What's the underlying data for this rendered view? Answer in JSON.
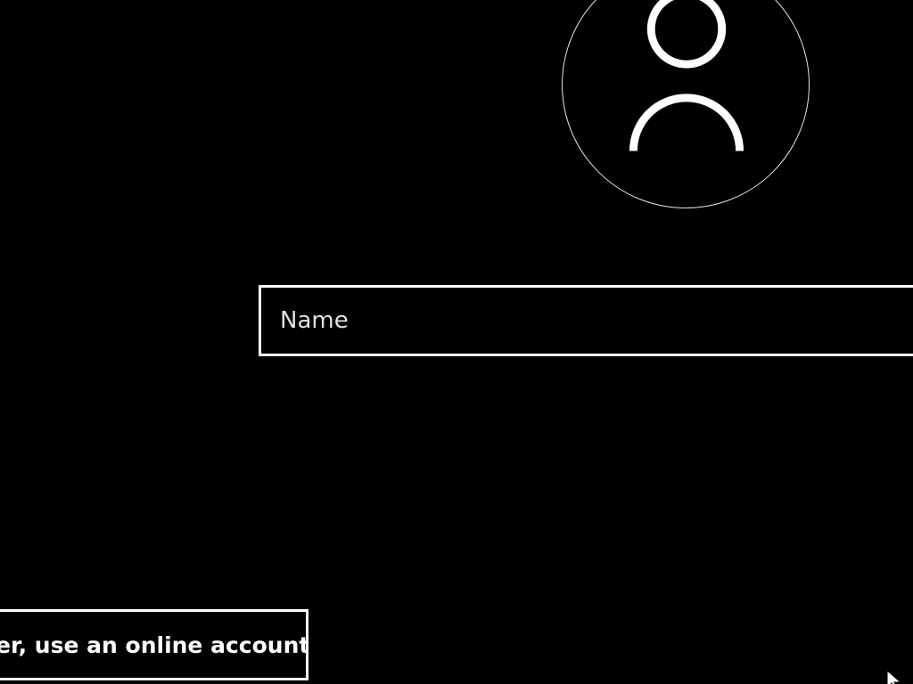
{
  "profile": {
    "icon": "user-avatar-icon",
    "ring_color": "#e6e6e6"
  },
  "name_field": {
    "placeholder": "Name",
    "value": ""
  },
  "online_account_link": {
    "label": "er, use an online account"
  },
  "cursor": {
    "icon": "mouse-pointer-icon"
  },
  "colors": {
    "background": "#000000",
    "foreground": "#ffffff"
  }
}
